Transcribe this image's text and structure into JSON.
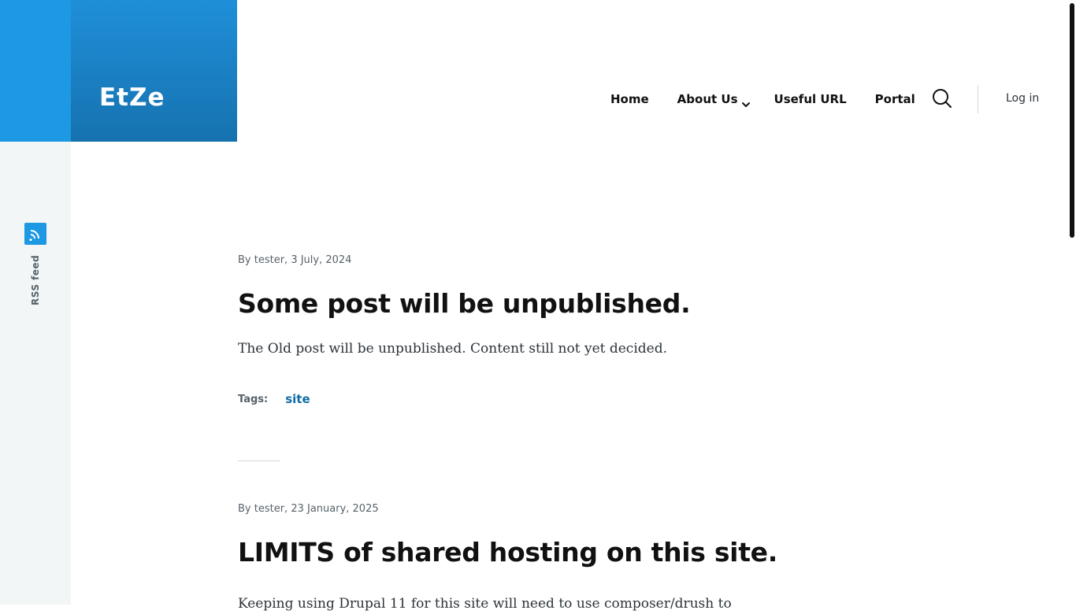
{
  "site": {
    "name": "EtZe"
  },
  "sidebar": {
    "rss_label": "RSS feed"
  },
  "nav": {
    "items": [
      {
        "label": "Home"
      },
      {
        "label": "About Us"
      },
      {
        "label": "Useful URL"
      },
      {
        "label": "Portal"
      }
    ],
    "login_label": "Log in"
  },
  "articles": [
    {
      "meta": "By tester, 3 July, 2024",
      "title": "Some post will be unpublished.",
      "body": "The Old post will be unpublished. Content still not yet decided.",
      "tags_label": "Tags:",
      "tags": [
        "site"
      ]
    },
    {
      "meta": "By tester, 23 January, 2025",
      "title": "LIMITS of shared hosting on this site.",
      "body": "Keeping using Drupal 11 for this site will need to use composer/drush to"
    }
  ],
  "colors": {
    "brand": "#1d98e3",
    "brand_dark": "#1672af",
    "link": "#0f6aa3",
    "rail_bg": "#f3f6f6"
  },
  "icons": {
    "rss": "rss-icon",
    "search": "search-icon",
    "chevron": "chevron-down-icon"
  }
}
